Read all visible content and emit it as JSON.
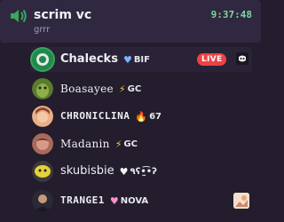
{
  "channel": {
    "name": "scrim vc",
    "timestamp": "9:37:48",
    "topic": "grrr"
  },
  "members": [
    {
      "name": "Chalecks",
      "tag_icon": "blue-heart-icon",
      "tag": "BIF",
      "live_label": "LIVE",
      "avatar_color": "#1f8a4c"
    },
    {
      "name": "Boasayee",
      "tag_icon": "lightning-icon",
      "tag": "GC",
      "avatar_color": "#6a8a3a"
    },
    {
      "name": "CHRONICLINA",
      "tag_icon": "fire-icon",
      "tag": "67",
      "avatar_color": "#d08a5a"
    },
    {
      "name": "Madanin",
      "tag_icon": "lightning-icon",
      "tag": "GC",
      "avatar_color": "#b07a6a"
    },
    {
      "name": "skubisbie",
      "tag_icon": "white-heart-icon",
      "tag": "٩ʕ•̫͡•ʔ",
      "avatar_color": "#c8b83a"
    },
    {
      "name": "TRANGE1",
      "tag_icon": "pink-heart-icon",
      "tag": "NOVA",
      "avatar_color": "#3a3a4a"
    }
  ],
  "colors": {
    "background": "#231d2d",
    "header": "#2f2840",
    "timestamp": "#7fd6a2",
    "live": "#ed4245",
    "speaking_ring": "#3aa55d"
  }
}
